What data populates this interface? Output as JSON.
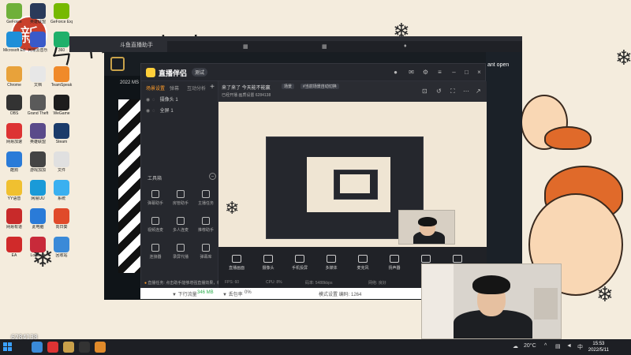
{
  "overlay_id": "6284138",
  "wallpaper": {
    "seal_char": "新",
    "scribble": "ㄣㄱㅋㄴ ㅣ ㅊ"
  },
  "desktop_icons": [
    {
      "label": "GeForce",
      "color": "#6fb03a"
    },
    {
      "label": "英雄联盟",
      "color": "#2a3a5a"
    },
    {
      "label": "GeForce Experience",
      "color": "#76b900"
    },
    {
      "label": "Microsoft Edge",
      "color": "#1f8fd8"
    },
    {
      "label": "网易云音乐",
      "color": "#3a5ac9"
    },
    {
      "label": "360",
      "color": "#1fb06a"
    },
    {
      "label": "Chrome",
      "color": "#e8a23a"
    },
    {
      "label": "文档",
      "color": "#e7e7e7"
    },
    {
      "label": "TeamSpeak",
      "color": "#f08a2a"
    },
    {
      "label": "OBS",
      "color": "#333"
    },
    {
      "label": "Grand Theft",
      "color": "#5a5a5a"
    },
    {
      "label": "WeGame",
      "color": "#1d1d1d"
    },
    {
      "label": "网易加速",
      "color": "#d33"
    },
    {
      "label": "英雄联盟",
      "color": "#5a4a8a"
    },
    {
      "label": "Steam",
      "color": "#1b3b6a"
    },
    {
      "label": "酷狗",
      "color": "#2a7bd8"
    },
    {
      "label": "游戏加加",
      "color": "#444"
    },
    {
      "label": "文件",
      "color": "#e0e0e0"
    },
    {
      "label": "YY语音",
      "color": "#f0c030"
    },
    {
      "label": "网易UU",
      "color": "#1a9ad8"
    },
    {
      "label": "系统",
      "color": "#3ab0f0"
    },
    {
      "label": "网易有道",
      "color": "#c82a2a"
    },
    {
      "label": "此电脑",
      "color": "#2a7bd8"
    },
    {
      "label": "向日葵",
      "color": "#e04a2a"
    },
    {
      "label": "EA",
      "color": "#d02a2a"
    },
    {
      "label": "Logitech",
      "color": "#c82a3a"
    },
    {
      "label": "回收站",
      "color": "#3a8ad8"
    }
  ],
  "back_window": {
    "title": "斗鱼直播助手",
    "lol_left_text": "2022 MS",
    "lol_numbers": [
      "35",
      "MS"
    ],
    "right_text": "ant open"
  },
  "app": {
    "title": "直播伴侣",
    "version": "测试",
    "sidebar_tabs": [
      "场景设置",
      "弹幕",
      "互动分析"
    ],
    "scenes": [
      "摄像头 1",
      "全屏 1"
    ],
    "toolbox_title": "工具箱",
    "tools": [
      "弹幕助手",
      "房管助手",
      "主播任务",
      "视频连麦",
      "多人连麦",
      "推荐助手",
      "连接器",
      "录屏代播",
      "弹幕库"
    ],
    "notice": "直播任务: 点击助手能够增强直播效果，敬请期待",
    "preview_caption": "来了来了 今天能不能赢",
    "preview_chips": [
      "场景",
      "#当前场景自动切换"
    ],
    "preview_line2": "已经开播  画质设置  6284138",
    "controls": [
      "直播画面",
      "摄像头",
      "手机投屏",
      "多媒体",
      "麦克风",
      "扬声器",
      "美颜",
      "更多"
    ],
    "stats": [
      "FPS: 60",
      "CPU: 8%",
      "码率: 5488kbps",
      "网络: 良好"
    ]
  },
  "bottom_strip": {
    "down_label": "▼ 下行流量",
    "down_value": "346 MB",
    "loss_label": "▼ 丢包率",
    "loss_value": "0%",
    "mid_text": "模式设置  编码: 1264"
  },
  "taskbar": {
    "apps": [
      "#3a8ad8",
      "#d33",
      "#c9a04a",
      "#333",
      "#e08a2a"
    ],
    "temp": "20°C",
    "clock_time": "15:53",
    "clock_date": "2022/5/11"
  }
}
